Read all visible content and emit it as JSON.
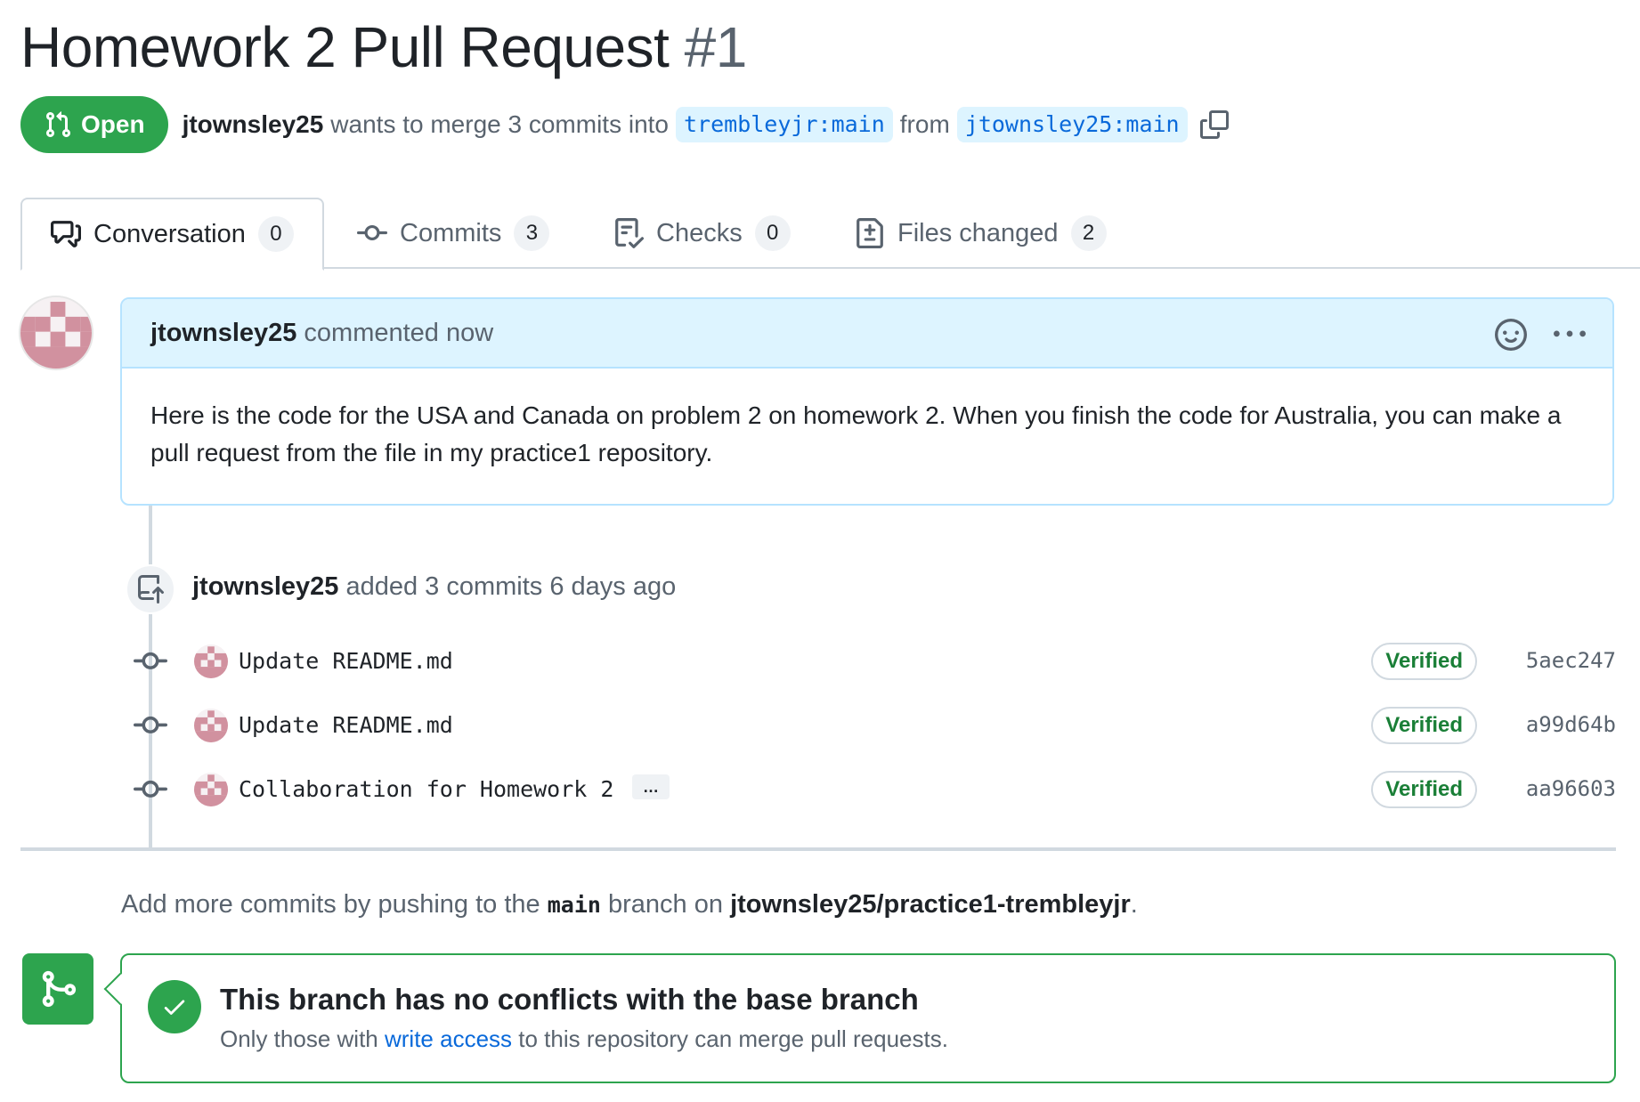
{
  "pr": {
    "title": "Homework 2 Pull Request",
    "number": "#1",
    "state": "Open",
    "author": "jtownsley25",
    "merge_text": "wants to merge 3 commits into",
    "base_branch": "trembleyjr:main",
    "from_text": "from",
    "head_branch": "jtownsley25:main"
  },
  "tabs": [
    {
      "label": "Conversation",
      "count": "0",
      "icon": "comment-discussion-icon"
    },
    {
      "label": "Commits",
      "count": "3",
      "icon": "git-commit-icon"
    },
    {
      "label": "Checks",
      "count": "0",
      "icon": "checklist-icon"
    },
    {
      "label": "Files changed",
      "count": "2",
      "icon": "file-diff-icon"
    }
  ],
  "comment": {
    "author": "jtownsley25",
    "action": "commented now",
    "body": "Here is the code for the USA and Canada on problem 2 on homework 2. When you finish the code for Australia, you can make a pull request from the file in my practice1 repository."
  },
  "push_event": {
    "author": "jtownsley25",
    "text": "added 3 commits 6 days ago"
  },
  "commits": [
    {
      "message": "Update README.md",
      "verified": "Verified",
      "sha": "5aec247",
      "has_ellipsis": false
    },
    {
      "message": "Update README.md",
      "verified": "Verified",
      "sha": "a99d64b",
      "has_ellipsis": false
    },
    {
      "message": "Collaboration for Homework 2",
      "verified": "Verified",
      "sha": "aa96603",
      "has_ellipsis": true,
      "ellipsis": "…"
    }
  ],
  "hint": {
    "prefix": "Add more commits by pushing to the",
    "branch": "main",
    "middle": "branch on",
    "repo": "jtownsley25/practice1-trembleyjr",
    "suffix": "."
  },
  "merge": {
    "title": "This branch has no conflicts with the base branch",
    "sub_prefix": "Only those with",
    "sub_link": "write access",
    "sub_suffix": "to this repository can merge pull requests."
  },
  "colors": {
    "open_green": "#2da44e",
    "verified_green": "#1a7f37",
    "link_blue": "#0969da",
    "comment_header_bg": "#ddf4ff",
    "avatar_pink": "#d1919f"
  }
}
